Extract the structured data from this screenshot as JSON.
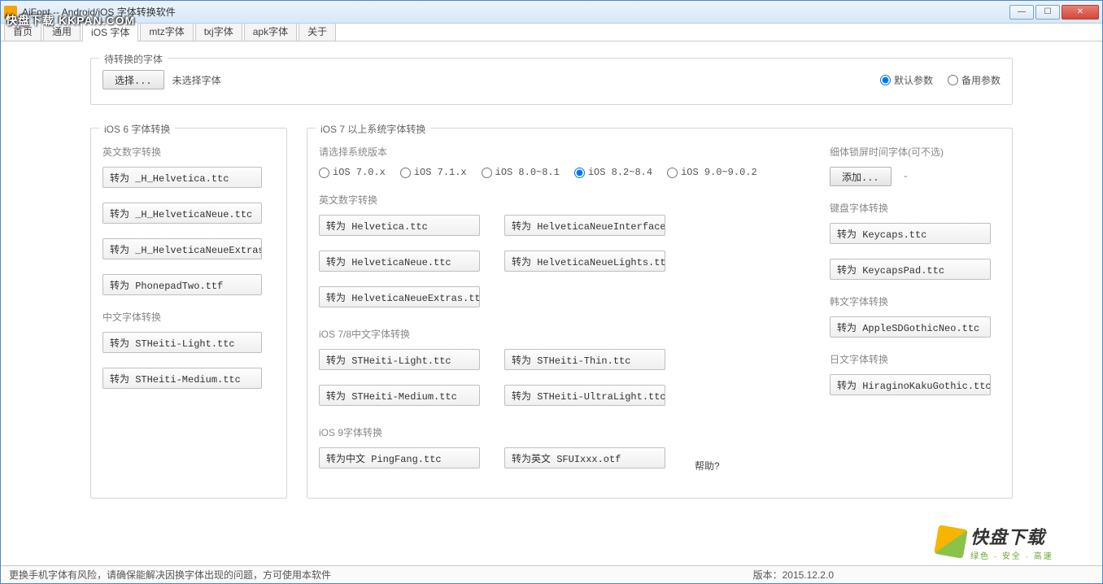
{
  "window": {
    "title": "AiFont -- Android/iOS 字体转换软件",
    "watermark": "快盘下载 KKPAN.COM"
  },
  "tabs": [
    "首页",
    "通用",
    "iOS 字体",
    "mtz字体",
    "txj字体",
    "apk字体",
    "关于"
  ],
  "active_tab": 2,
  "top": {
    "legend": "待转换的字体",
    "select_btn": "选择...",
    "no_select": "未选择字体",
    "radio_default": "默认参数",
    "radio_backup": "备用参数"
  },
  "ios6": {
    "legend": "iOS 6 字体转换",
    "en_label": "英文数字转换",
    "en_buttons": [
      "转为 _H_Helvetica.ttc",
      "转为 _H_HelveticaNeue.ttc",
      "转为 _H_HelveticaNeueExtras.ttc",
      "转为 PhonepadTwo.ttf"
    ],
    "cn_label": "中文字体转换",
    "cn_buttons": [
      "转为 STHeiti-Light.ttc",
      "转为 STHeiti-Medium.ttc"
    ]
  },
  "ios7": {
    "legend": "iOS 7 以上系统字体转换",
    "version_label": "请选择系统版本",
    "versions": [
      "iOS 7.0.x",
      "iOS 7.1.x",
      "iOS 8.0~8.1",
      "iOS 8.2~8.4",
      "iOS 9.0~9.0.2"
    ],
    "version_selected": 3,
    "en_label": "英文数字转换",
    "en_left": [
      "转为 Helvetica.ttc",
      "转为 HelveticaNeue.ttc",
      "转为 HelveticaNeueExtras.ttc"
    ],
    "en_right": [
      "转为 HelveticaNeueInterface.ttc",
      "转为 HelveticaNeueLights.ttc"
    ],
    "cn_label": "iOS 7/8中文字体转换",
    "cn_left": [
      "转为 STHeiti-Light.ttc",
      "转为 STHeiti-Medium.ttc"
    ],
    "cn_right": [
      "转为 STHeiti-Thin.ttc",
      "转为 STHeiti-UltraLight.ttc"
    ],
    "ios9_label": "iOS 9字体转换",
    "ios9_left": "转为中文 PingFang.ttc",
    "ios9_right": "转为英文 SFUIxxx.otf",
    "help": "帮助?",
    "thin_label": "细体锁屏时间字体(可不选)",
    "add_btn": "添加...",
    "dash": "-",
    "kb_label": "键盘字体转换",
    "kb_buttons": [
      "转为 Keycaps.ttc",
      "转为 KeycapsPad.ttc"
    ],
    "kr_label": "韩文字体转换",
    "kr_button": "转为 AppleSDGothicNeo.ttc",
    "jp_label": "日文字体转换",
    "jp_button": "转为 HiraginoKakuGothic.ttc"
  },
  "status": {
    "text": "更换手机字体有风险，请确保能解决因换字体出现的问题，方可使用本软件",
    "version": "版本：2015.12.2.0"
  },
  "brand": {
    "big": "快盘下载",
    "small": "绿色 · 安全 · 高速"
  }
}
